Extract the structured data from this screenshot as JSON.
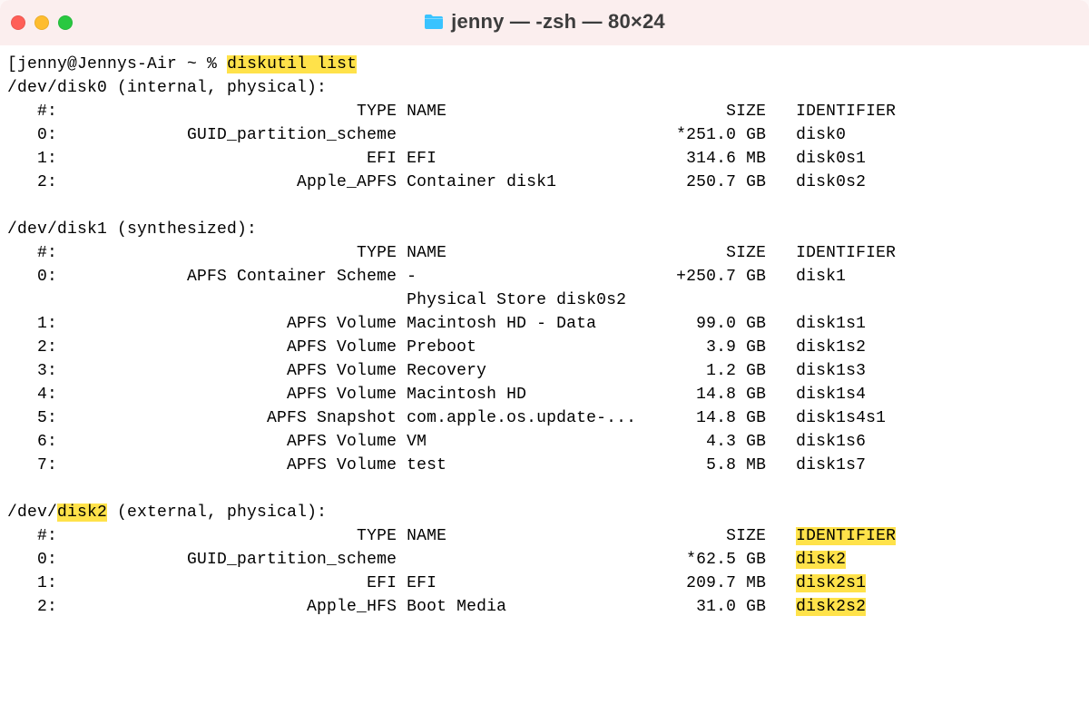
{
  "window": {
    "title": "jenny — -zsh — 80×24"
  },
  "prompt": {
    "prefix": "jenny@Jennys-Air ~ % ",
    "command": "diskutil list"
  },
  "disks": [
    {
      "device": "/dev/disk0",
      "attrs": " (internal, physical):",
      "device_hl_start": null,
      "device_hl_end": null,
      "header": {
        "num": "#:",
        "type": "TYPE",
        "name": "NAME",
        "size": "SIZE",
        "identifier": "IDENTIFIER",
        "id_hl": false
      },
      "rows": [
        {
          "num": "0:",
          "type": "GUID_partition_scheme",
          "name": "",
          "size": "*251.0 GB",
          "identifier": "disk0",
          "id_hl": false
        },
        {
          "num": "1:",
          "type": "EFI",
          "name": "EFI",
          "size": "314.6 MB",
          "identifier": "disk0s1",
          "id_hl": false
        },
        {
          "num": "2:",
          "type": "Apple_APFS",
          "name": "Container disk1",
          "size": "250.7 GB",
          "identifier": "disk0s2",
          "id_hl": false
        }
      ],
      "extras": []
    },
    {
      "device": "/dev/disk1",
      "attrs": " (synthesized):",
      "device_hl_start": null,
      "device_hl_end": null,
      "header": {
        "num": "#:",
        "type": "TYPE",
        "name": "NAME",
        "size": "SIZE",
        "identifier": "IDENTIFIER",
        "id_hl": false
      },
      "rows": [
        {
          "num": "0:",
          "type": "APFS Container Scheme",
          "name": "-",
          "size": "+250.7 GB",
          "identifier": "disk1",
          "id_hl": false
        }
      ],
      "extras": [
        {
          "text": "Physical Store disk0s2",
          "name_col": true
        }
      ],
      "rows2": [
        {
          "num": "1:",
          "type": "APFS Volume",
          "name": "Macintosh HD - Data",
          "size": "99.0 GB",
          "identifier": "disk1s1",
          "id_hl": false
        },
        {
          "num": "2:",
          "type": "APFS Volume",
          "name": "Preboot",
          "size": "3.9 GB",
          "identifier": "disk1s2",
          "id_hl": false
        },
        {
          "num": "3:",
          "type": "APFS Volume",
          "name": "Recovery",
          "size": "1.2 GB",
          "identifier": "disk1s3",
          "id_hl": false
        },
        {
          "num": "4:",
          "type": "APFS Volume",
          "name": "Macintosh HD",
          "size": "14.8 GB",
          "identifier": "disk1s4",
          "id_hl": false
        },
        {
          "num": "5:",
          "type": "APFS Snapshot",
          "name": "com.apple.os.update-...",
          "size": "14.8 GB",
          "identifier": "disk1s4s1",
          "id_hl": false
        },
        {
          "num": "6:",
          "type": "APFS Volume",
          "name": "VM",
          "size": "4.3 GB",
          "identifier": "disk1s6",
          "id_hl": false
        },
        {
          "num": "7:",
          "type": "APFS Volume",
          "name": "test",
          "size": "5.8 MB",
          "identifier": "disk1s7",
          "id_hl": false
        }
      ]
    },
    {
      "device": "/dev/disk2",
      "attrs": " (external, physical):",
      "device_hl_start": 5,
      "device_hl_end": 10,
      "header": {
        "num": "#:",
        "type": "TYPE",
        "name": "NAME",
        "size": "SIZE",
        "identifier": "IDENTIFIER",
        "id_hl": true
      },
      "rows": [
        {
          "num": "0:",
          "type": "GUID_partition_scheme",
          "name": "",
          "size": "*62.5 GB",
          "identifier": "disk2",
          "id_hl": true
        },
        {
          "num": "1:",
          "type": "EFI",
          "name": "EFI",
          "size": "209.7 MB",
          "identifier": "disk2s1",
          "id_hl": true
        },
        {
          "num": "2:",
          "type": "Apple_HFS",
          "name": "Boot Media",
          "size": "31.0 GB",
          "identifier": "disk2s2",
          "id_hl": true
        }
      ],
      "extras": []
    }
  ],
  "columns": {
    "num_width": 5,
    "type_width": 34,
    "name_width": 25,
    "size_width": 12,
    "id_width": 12
  }
}
